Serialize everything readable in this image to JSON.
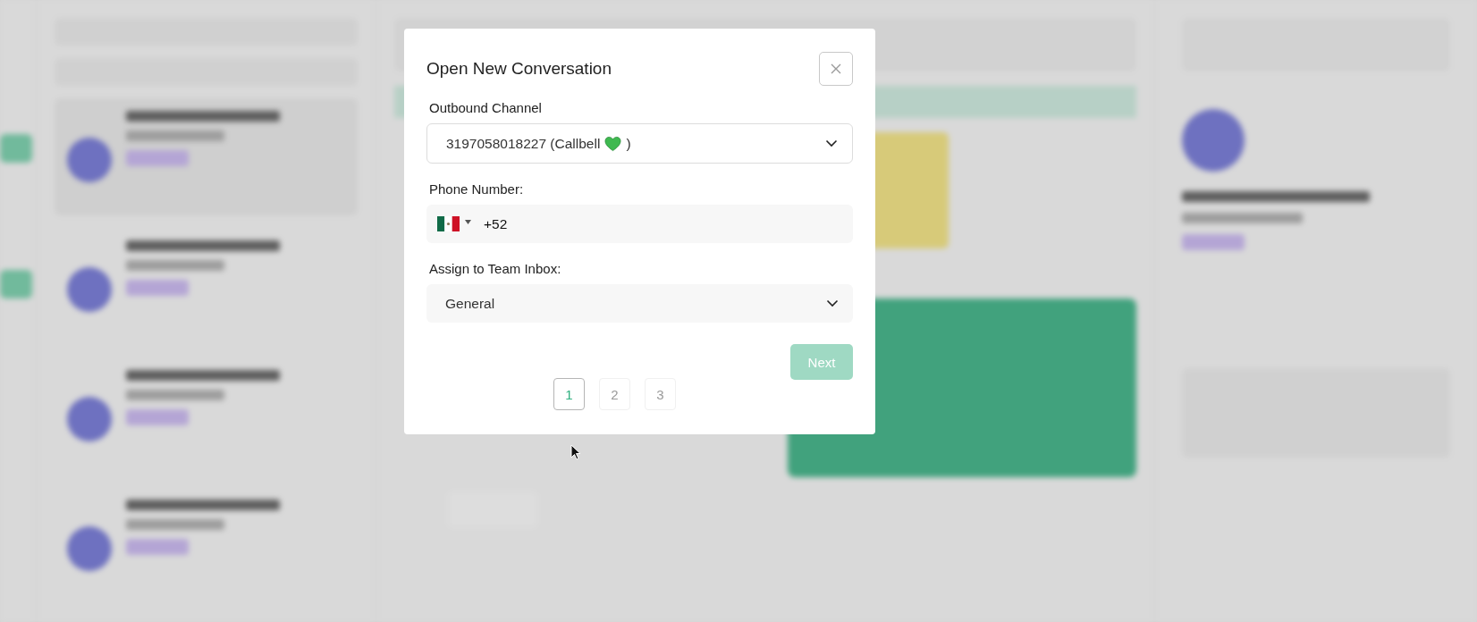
{
  "dialog": {
    "title": "Open New Conversation",
    "outbound_channel": {
      "label": "Outbound Channel",
      "value_prefix": "3197058018227 (Callbell",
      "value_suffix": ")"
    },
    "phone_number": {
      "label": "Phone Number:",
      "dial_code": "+52"
    },
    "team_inbox": {
      "label": "Assign to Team Inbox:",
      "value": "General"
    },
    "next_button": {
      "label": "Next",
      "disabled": true
    },
    "steps": [
      {
        "label": "1",
        "selected": true
      },
      {
        "label": "2",
        "selected": false
      },
      {
        "label": "3",
        "selected": false
      }
    ]
  }
}
